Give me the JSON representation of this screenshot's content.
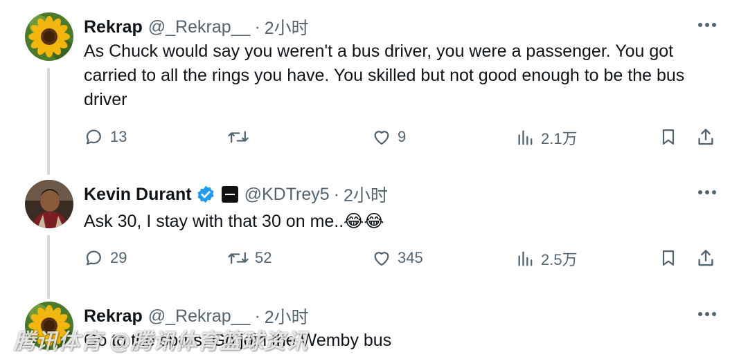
{
  "tweets": [
    {
      "name": "Rekrap",
      "handle": "@_Rekrap__",
      "dot": "·",
      "time": "2小时",
      "text": "As Chuck would say you weren't a bus driver, you were a passenger. You got carried to all the rings you have. You skilled but not good enough to be the bus driver",
      "replies": "13",
      "retweets": "",
      "likes": "9",
      "views": "2.1万",
      "avatar_icon": "sunflower-avatar"
    },
    {
      "name": "Kevin Durant",
      "handle": "@KDTrey5",
      "dot": "·",
      "time": "2小时",
      "text": "Ask 30, I stay with that 30 on me..😂😂",
      "replies": "29",
      "retweets": "52",
      "likes": "345",
      "views": "2.5万",
      "avatar_icon": "person-photo-avatar",
      "verified_icon": "verified-badge-icon",
      "affiliation_icon": "affiliation-badge-icon"
    },
    {
      "name": "Rekrap",
      "handle": "@_Rekrap__",
      "dot": "·",
      "time": "2小时",
      "text": "Go to the spurs. Go join the Wemby bus",
      "avatar_icon": "sunflower-avatar"
    }
  ],
  "watermark": "腾讯体育 @腾讯体育篮球资讯",
  "colors": {
    "text": "#0f1419",
    "secondary": "#536471",
    "thread_line": "#cfd9de",
    "verified": "#1d9bf0"
  }
}
